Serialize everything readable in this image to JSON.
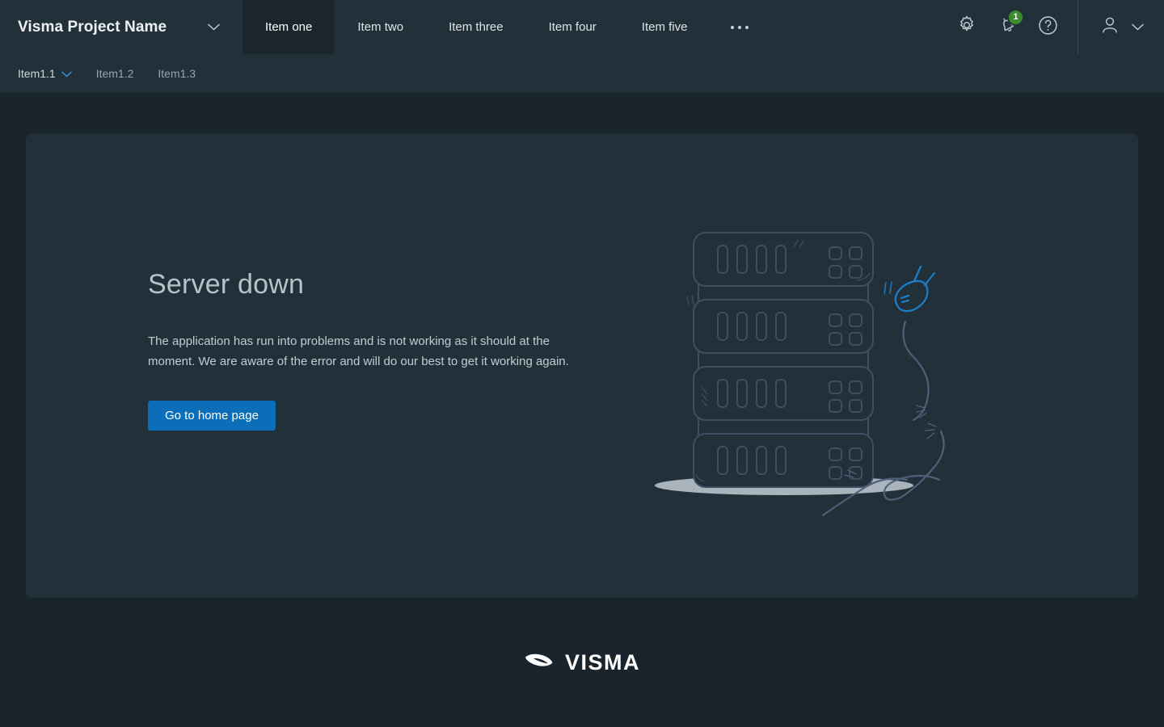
{
  "header": {
    "brand": {
      "name": "Visma Project Name",
      "caret_icon": "chevron-down-icon"
    },
    "tabs": [
      {
        "label": "Item one",
        "active": true
      },
      {
        "label": "Item two",
        "active": false
      },
      {
        "label": "Item three",
        "active": false
      },
      {
        "label": "Item four",
        "active": false
      },
      {
        "label": "Item five",
        "active": false
      }
    ],
    "more_label": "...",
    "icons": [
      {
        "name": "gear-icon",
        "tooltip": "Settings"
      },
      {
        "name": "bell-icon",
        "tooltip": "Notifications",
        "badge": "1"
      },
      {
        "name": "help-icon",
        "tooltip": "Help"
      }
    ],
    "notification_badge": "1",
    "user": {
      "avatar_icon": "user-avatar-icon",
      "caret_icon": "chevron-down-icon"
    }
  },
  "subnav": {
    "items": [
      {
        "label": "Item1.1",
        "active": true,
        "has_caret": true
      },
      {
        "label": "Item1.2",
        "active": false,
        "has_caret": false
      },
      {
        "label": "Item1.3",
        "active": false,
        "has_caret": false
      }
    ]
  },
  "main": {
    "title": "Server down",
    "message": "The application has run into problems and is not working as it should at the moment. We are aware of the error and will do our best to get it working again.",
    "button_label": "Go to home page",
    "illustration": "server-rack-unplugged-illustration"
  },
  "footer": {
    "logo_text": "VISMA",
    "logo_mark": "visma-swoosh-icon"
  },
  "colors": {
    "page_background": "#1a242c",
    "header_background": "#223039",
    "active_tab_background": "#1a252c",
    "card_background": "#223039",
    "primary_button": "#0c6eb8",
    "badge_green": "#3d8b2f",
    "plug_blue": "#1b7fc9",
    "illustration_line": "#3d4f60",
    "shadow_gray": "#aab4bd",
    "title_text": "#b7c3cb",
    "body_text": "#c2ccd3"
  }
}
